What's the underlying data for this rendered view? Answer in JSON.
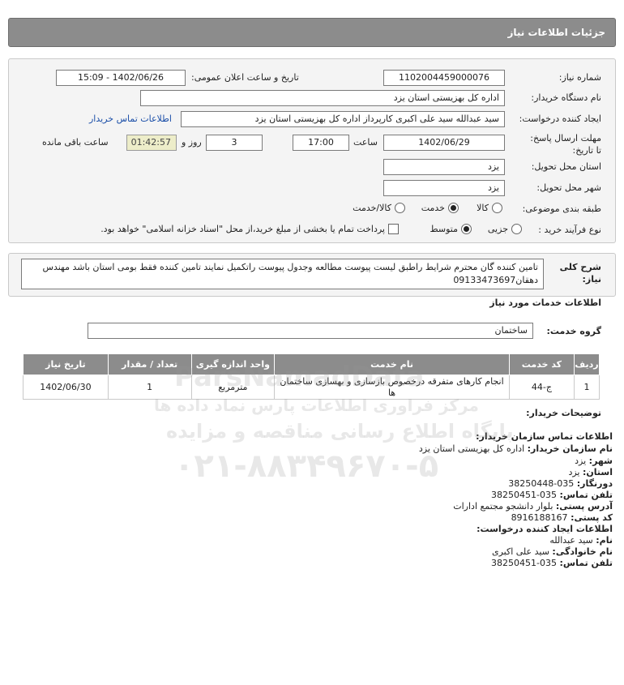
{
  "header": {
    "title": "جزئیات اطلاعات نیاز"
  },
  "form": {
    "need_number_label": "شماره نیاز:",
    "need_number": "1102004459000076",
    "announce_label": "تاریخ و ساعت اعلان عمومی:",
    "announce_value": "1402/06/26 - 15:09",
    "buyer_org_label": "نام دستگاه خریدار:",
    "buyer_org": "اداره کل بهزیستی استان یزد",
    "requester_label": "ایجاد کننده درخواست:",
    "requester": "سید عبدالله سید علی اکبری کارپرداز اداره کل بهزیستی استان یزد",
    "contact_link": "اطلاعات تماس خریدار",
    "deadline_label": "مهلت ارسال پاسخ: تا تاریخ:",
    "deadline_date": "1402/06/29",
    "time_label": "ساعت",
    "deadline_time": "17:00",
    "days_value": "3",
    "days_label": "روز و",
    "remaining_time": "01:42:57",
    "remaining_label": "ساعت باقی مانده",
    "province_label": "استان محل تحویل:",
    "province": "یزد",
    "city_label": "شهر محل تحویل:",
    "city": "یزد",
    "category_label": "طبقه بندی موضوعی:",
    "category_options": [
      {
        "label": "کالا",
        "selected": false
      },
      {
        "label": "خدمت",
        "selected": true
      },
      {
        "label": "کالا/خدمت",
        "selected": false
      }
    ],
    "process_label": "نوع فرآیند خرید :",
    "process_options": [
      {
        "label": "جزیی",
        "selected": false
      },
      {
        "label": "متوسط",
        "selected": true
      }
    ],
    "payment_note": "پرداخت تمام یا بخشی از مبلغ خرید،از محل \"اسناد خزانه اسلامی\" خواهد بود."
  },
  "description": {
    "label": "شرح کلی نیاز:",
    "text": "تامین کننده گان محترم شرایط راطبق لیست پیوست مطالعه وجدول پیوست راتکمیل نمایند تامین کننده فقط بومی استان باشد مهندس دهقان09133473697"
  },
  "services": {
    "section_title": "اطلاعات خدمات مورد نیاز",
    "group_label": "گروه خدمت:",
    "group_value": "ساختمان",
    "columns": [
      "ردیف",
      "کد خدمت",
      "نام خدمت",
      "واحد اندازه گیری",
      "تعداد / مقدار",
      "تاریخ نیاز"
    ],
    "rows": [
      [
        "1",
        "ج-44",
        "انجام کارهای متفرقه درخصوص بازسازی و بهسازی ساختمان ها",
        "مترمربع",
        "1",
        "1402/06/30"
      ]
    ]
  },
  "buyer_notes_label": "توضیحات خریدار:",
  "contact": {
    "title": "اطلاعات تماس سازمان خریدار:",
    "org_label": "نام سازمان خریدار:",
    "org": "اداره کل بهزیستی استان یزد",
    "city_label": "شهر:",
    "city": "یزد",
    "province_label": "استان:",
    "province": "یزد",
    "fax_label": "دورنگار:",
    "fax": "035-38250448",
    "phone_label": "تلفن تماس:",
    "phone": "035-38250451",
    "address_label": "آدرس پستی:",
    "address": "بلوار دانشجو مجتمع ادارات",
    "postal_label": "کد پستی:",
    "postal": "8916188167",
    "creator_title": "اطلاعات ایجاد کننده درخواست:",
    "name_label": "نام:",
    "name": "سید عبدالله",
    "family_label": "نام خانوادگی:",
    "family": "سید علی اکبری",
    "creator_phone_label": "تلفن تماس:",
    "creator_phone": "035-38250451"
  },
  "watermark": {
    "brand": "ParsNamadData",
    "line1": "مرکز فراوری اطلاعات پارس نماد داده ها",
    "line2": "پایگاه اطلاع رسانی مناقصه و مزایده",
    "phone": "۰۲۱-۸۸۳۴۹۶۷۰-۵"
  }
}
